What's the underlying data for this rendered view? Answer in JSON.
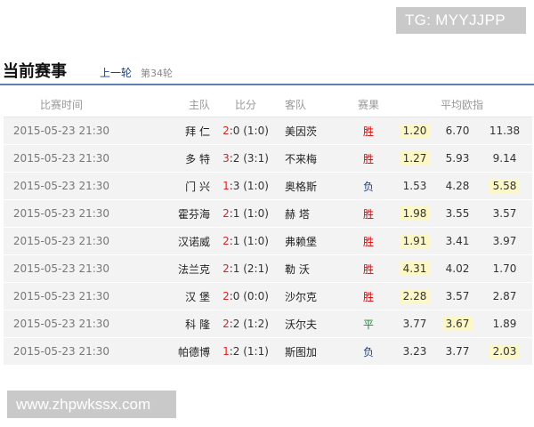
{
  "watermarks": {
    "top": "TG: MYYJJPP",
    "bottom": "www.zhpwkssx.com"
  },
  "header": {
    "title": "当前赛事",
    "prev_round": "上一轮",
    "round": "第34轮"
  },
  "columns": {
    "time": "比赛时间",
    "home": "主队",
    "score": "比分",
    "away": "客队",
    "result": "赛果",
    "odds": "平均欧指"
  },
  "colors": {
    "win": "#d40000",
    "lose": "#1a3f8a",
    "draw": "#198a2c",
    "highlight": "#fbf7c6",
    "header_rule": "#5f7fb5"
  },
  "matches": [
    {
      "time": "2015-05-23 21:30",
      "home": "拜 仁",
      "score_home": "2",
      "score_rest": ":0 (1:0)",
      "away": "美因茨",
      "result": "胜",
      "result_type": "win",
      "odds": [
        "1.20",
        "6.70",
        "11.38"
      ],
      "highlight": 0
    },
    {
      "time": "2015-05-23 21:30",
      "home": "多 特",
      "score_home": "3",
      "score_rest": ":2 (3:1)",
      "away": "不来梅",
      "result": "胜",
      "result_type": "win",
      "odds": [
        "1.27",
        "5.93",
        "9.14"
      ],
      "highlight": 0
    },
    {
      "time": "2015-05-23 21:30",
      "home": "门 兴",
      "score_home": "1",
      "score_rest": ":3 (1:0)",
      "away": "奥格斯",
      "result": "负",
      "result_type": "lose",
      "odds": [
        "1.53",
        "4.28",
        "5.58"
      ],
      "highlight": 2
    },
    {
      "time": "2015-05-23 21:30",
      "home": "霍芬海",
      "score_home": "2",
      "score_rest": ":1 (1:0)",
      "away": "赫 塔",
      "result": "胜",
      "result_type": "win",
      "odds": [
        "1.98",
        "3.55",
        "3.57"
      ],
      "highlight": 0
    },
    {
      "time": "2015-05-23 21:30",
      "home": "汉诺威",
      "score_home": "2",
      "score_rest": ":1 (1:0)",
      "away": "弗赖堡",
      "result": "胜",
      "result_type": "win",
      "odds": [
        "1.91",
        "3.41",
        "3.97"
      ],
      "highlight": 0
    },
    {
      "time": "2015-05-23 21:30",
      "home": "法兰克",
      "score_home": "2",
      "score_rest": ":1 (2:1)",
      "away": "勒 沃",
      "result": "胜",
      "result_type": "win",
      "odds": [
        "4.31",
        "4.02",
        "1.70"
      ],
      "highlight": 0
    },
    {
      "time": "2015-05-23 21:30",
      "home": "汉 堡",
      "score_home": "2",
      "score_rest": ":0 (0:0)",
      "away": "沙尔克",
      "result": "胜",
      "result_type": "win",
      "odds": [
        "2.28",
        "3.57",
        "2.87"
      ],
      "highlight": 0
    },
    {
      "time": "2015-05-23 21:30",
      "home": "科 隆",
      "score_home": "2",
      "score_rest": ":2 (1:2)",
      "away": "沃尔夫",
      "result": "平",
      "result_type": "draw",
      "odds": [
        "3.77",
        "3.67",
        "1.89"
      ],
      "highlight": 1
    },
    {
      "time": "2015-05-23 21:30",
      "home": "帕德博",
      "score_home": "1",
      "score_rest": ":2 (1:1)",
      "away": "斯图加",
      "result": "负",
      "result_type": "lose",
      "odds": [
        "3.23",
        "3.77",
        "2.03"
      ],
      "highlight": 2
    }
  ]
}
